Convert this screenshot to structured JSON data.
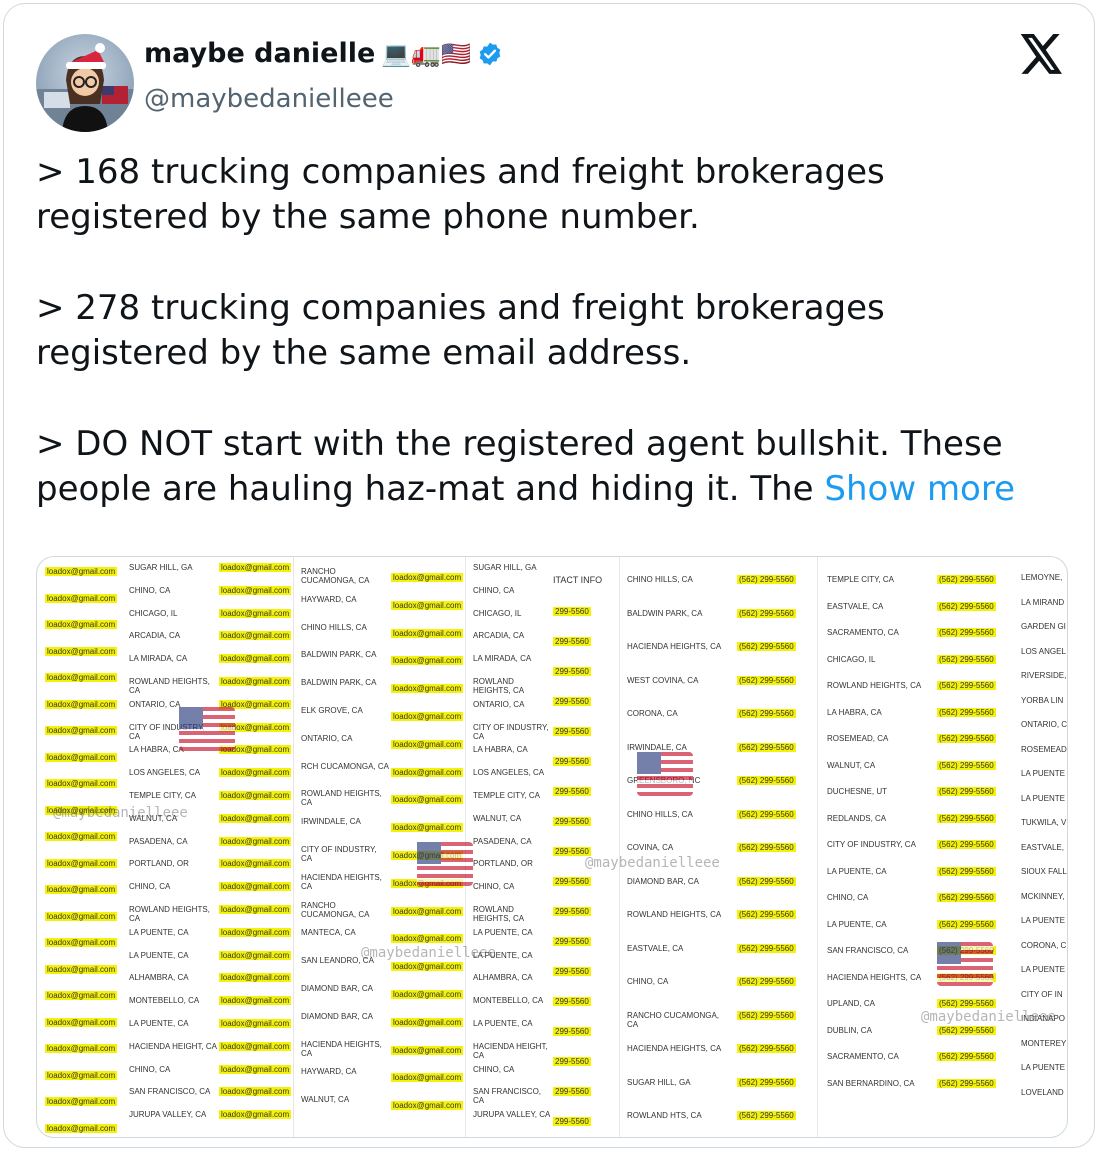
{
  "author": {
    "name": "maybe danielle",
    "emoji": "💻🚛🇺🇸",
    "handle": "@maybedanielleee",
    "verified": true,
    "verified_color": "#1d9bf0"
  },
  "platform_icon": "x-logo-icon",
  "tweet": {
    "paragraphs": [
      "> 168 trucking companies and freight brokerages registered by the same phone number.",
      "> 278 trucking companies and freight brokerages registered by the same email address."
    ],
    "last_paragraph": "> DO NOT start with the registered agent bullshit. These people are hauling haz-mat and hiding it. The",
    "show_more": "Show more"
  },
  "media": {
    "watermark": "@maybedanielleee",
    "email": "loadox@gmail.com",
    "phone": "(562) 299-5560",
    "phone_partial": "299-5560",
    "header_contact": "ITACT INFO",
    "col_a_cities": [
      "SUGAR HILL, GA",
      "CHINO, CA",
      "CHICAGO, IL",
      "ARCADIA, CA",
      "LA MIRADA, CA",
      "ROWLAND HEIGHTS, CA",
      "ONTARIO, CA",
      "CITY OF INDUSTRY, CA",
      "LA HABRA, CA",
      "LOS ANGELES, CA",
      "TEMPLE CITY, CA",
      "WALNUT, CA",
      "PASADENA, CA",
      "PORTLAND, OR",
      "CHINO, CA",
      "ROWLAND HEIGHTS, CA",
      "LA PUENTE, CA",
      "LA PUENTE, CA",
      "ALHAMBRA, CA",
      "MONTEBELLO, CA",
      "LA PUENTE, CA",
      "HACIENDA HEIGHT, CA",
      "CHINO, CA",
      "SAN FRANCISCO, CA",
      "JURUPA VALLEY, CA"
    ],
    "col_b_cities": [
      "RANCHO CUCAMONGA, CA",
      "HAYWARD, CA",
      "CHINO HILLS, CA",
      "BALDWIN PARK, CA",
      "BALDWIN PARK, CA",
      "ELK GROVE, CA",
      "ONTARIO, CA",
      "RCH CUCAMONGA, CA",
      "ROWLAND HEIGHTS, CA",
      "IRWINDALE, CA",
      "CITY OF INDUSTRY, CA",
      "HACIENDA HEIGHTS, CA",
      "RANCHO CUCAMONGA, CA",
      "MANTECA, CA",
      "SAN LEANDRO, CA",
      "DIAMOND BAR, CA",
      "DIAMOND BAR, CA",
      "HACIENDA HEIGHTS, CA",
      "HAYWARD, CA",
      "WALNUT, CA"
    ],
    "col_d_cities": [
      "CHINO HILLS, CA",
      "BALDWIN PARK, CA",
      "HACIENDA HEIGHTS, CA",
      "WEST COVINA, CA",
      "CORONA, CA",
      "IRWINDALE, CA",
      "GREENSBORO, NC",
      "CHINO HILLS, CA",
      "COVINA, CA",
      "DIAMOND BAR, CA",
      "ROWLAND HEIGHTS, CA",
      "EASTVALE, CA",
      "CHINO, CA",
      "RANCHO CUCAMONGA, CA",
      "HACIENDA HEIGHTS, CA",
      "SUGAR HILL, GA",
      "ROWLAND HTS, CA"
    ],
    "col_e_cities": [
      "TEMPLE CITY, CA",
      "EASTVALE, CA",
      "SACRAMENTO, CA",
      "CHICAGO, IL",
      "ROWLAND HEIGHTS, CA",
      "LA HABRA, CA",
      "ROSEMEAD, CA",
      "WALNUT, CA",
      "DUCHESNE, UT",
      "REDLANDS, CA",
      "CITY OF INDUSTRY, CA",
      "LA PUENTE, CA",
      "CHINO, CA",
      "LA PUENTE, CA",
      "SAN FRANCISCO, CA",
      "HACIENDA HEIGHTS, CA",
      "UPLAND, CA",
      "DUBLIN, CA",
      "SACRAMENTO, CA",
      "SAN BERNARDINO, CA"
    ],
    "col_f_cities": [
      "LEMOYNE,",
      "LA MIRAND",
      "GARDEN GI",
      "LOS ANGEL",
      "RIVERSIDE,",
      "YORBA LIN",
      "ONTARIO, C",
      "ROSEMEAD",
      "LA PUENTE",
      "LA PUENTE",
      "TUKWILA, V",
      "EASTVALE,",
      "SIOUX FALL",
      "MCKINNEY,",
      "LA PUENTE",
      "CORONA, C",
      "LA PUENTE",
      "CITY OF IN",
      "INDIANAPO",
      "MONTEREY",
      "LA PUENTE",
      "LOVELAND"
    ]
  }
}
